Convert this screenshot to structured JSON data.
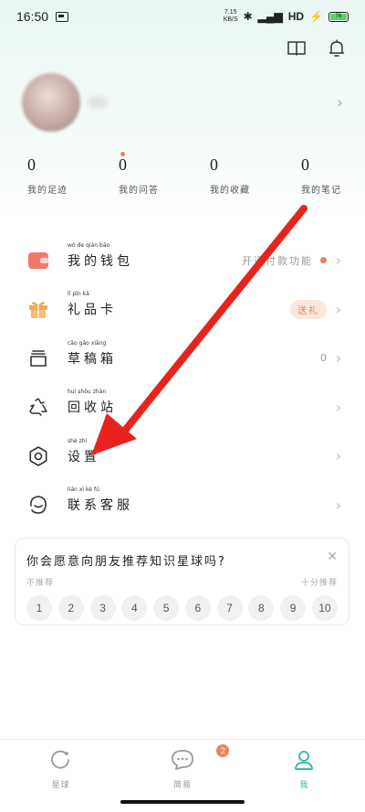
{
  "status_bar": {
    "time": "16:50",
    "speed_value": "7.15",
    "speed_unit": "KB/S",
    "network": "HD",
    "battery": "76"
  },
  "stats": [
    {
      "value": "0",
      "label": "我的足迹"
    },
    {
      "value": "0",
      "label": "我的问答"
    },
    {
      "value": "0",
      "label": "我的收藏"
    },
    {
      "value": "0",
      "label": "我的笔记"
    }
  ],
  "menu": [
    {
      "label": "我的钱包",
      "pinyin": [
        "wǒ",
        "de",
        "qián",
        "bāo"
      ],
      "icon": "wallet-icon",
      "extra": "开通付款功能"
    },
    {
      "label": "礼品卡",
      "pinyin": [
        "lǐ",
        "pǐn",
        "kǎ"
      ],
      "icon": "gift-icon",
      "badge": "送礼"
    },
    {
      "label": "草稿箱",
      "pinyin": [
        "cǎo",
        "gǎo",
        "xiāng"
      ],
      "icon": "drafts-icon",
      "count": "0"
    },
    {
      "label": "回收站",
      "pinyin": [
        "huí",
        "shōu",
        "zhàn"
      ],
      "icon": "recycle-icon"
    },
    {
      "label": "设置",
      "pinyin": [
        "shè",
        "zhì"
      ],
      "icon": "settings-icon"
    },
    {
      "label": "联系客服",
      "pinyin": [
        "lián",
        "xì",
        "kè",
        "fú"
      ],
      "icon": "customer-service-icon"
    }
  ],
  "survey": {
    "question": "你会愿意向朋友推荐知识星球吗?",
    "low_label": "不推荐",
    "high_label": "十分推荐",
    "options": [
      "1",
      "2",
      "3",
      "4",
      "5",
      "6",
      "7",
      "8",
      "9",
      "10"
    ]
  },
  "tabbar": {
    "tabs": [
      {
        "label": "星球",
        "icon": "planet-icon"
      },
      {
        "label": "简易",
        "icon": "message-icon",
        "badge": "2"
      },
      {
        "label": "我",
        "icon": "profile-icon"
      }
    ]
  },
  "colors": {
    "accent": "#2bb89c",
    "badge": "#e9835f",
    "arrow": "#e8231e"
  }
}
